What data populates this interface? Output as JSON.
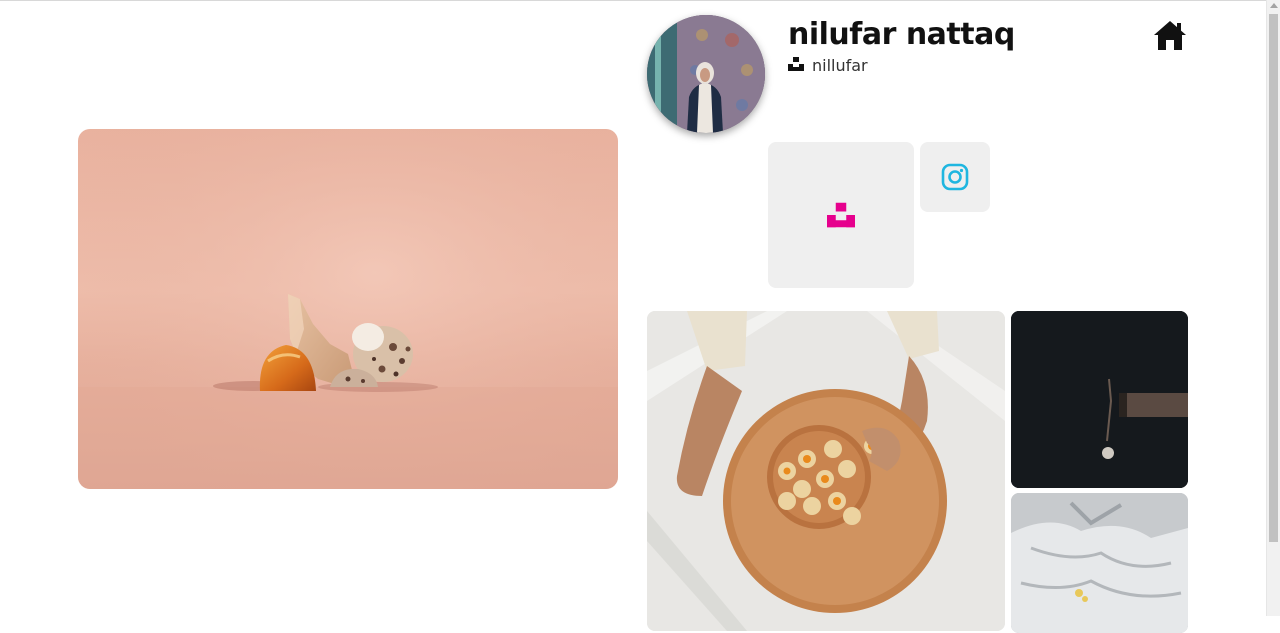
{
  "profile": {
    "name": "nilufar nattaq",
    "username": "nillufar"
  },
  "icons": {
    "home": "home-icon",
    "unsplash": "unsplash-icon",
    "instagram": "instagram-icon"
  },
  "colors": {
    "unsplash_accent": "#e6008d",
    "instagram_accent": "#1fb6e0",
    "tile_background": "#efefef"
  }
}
